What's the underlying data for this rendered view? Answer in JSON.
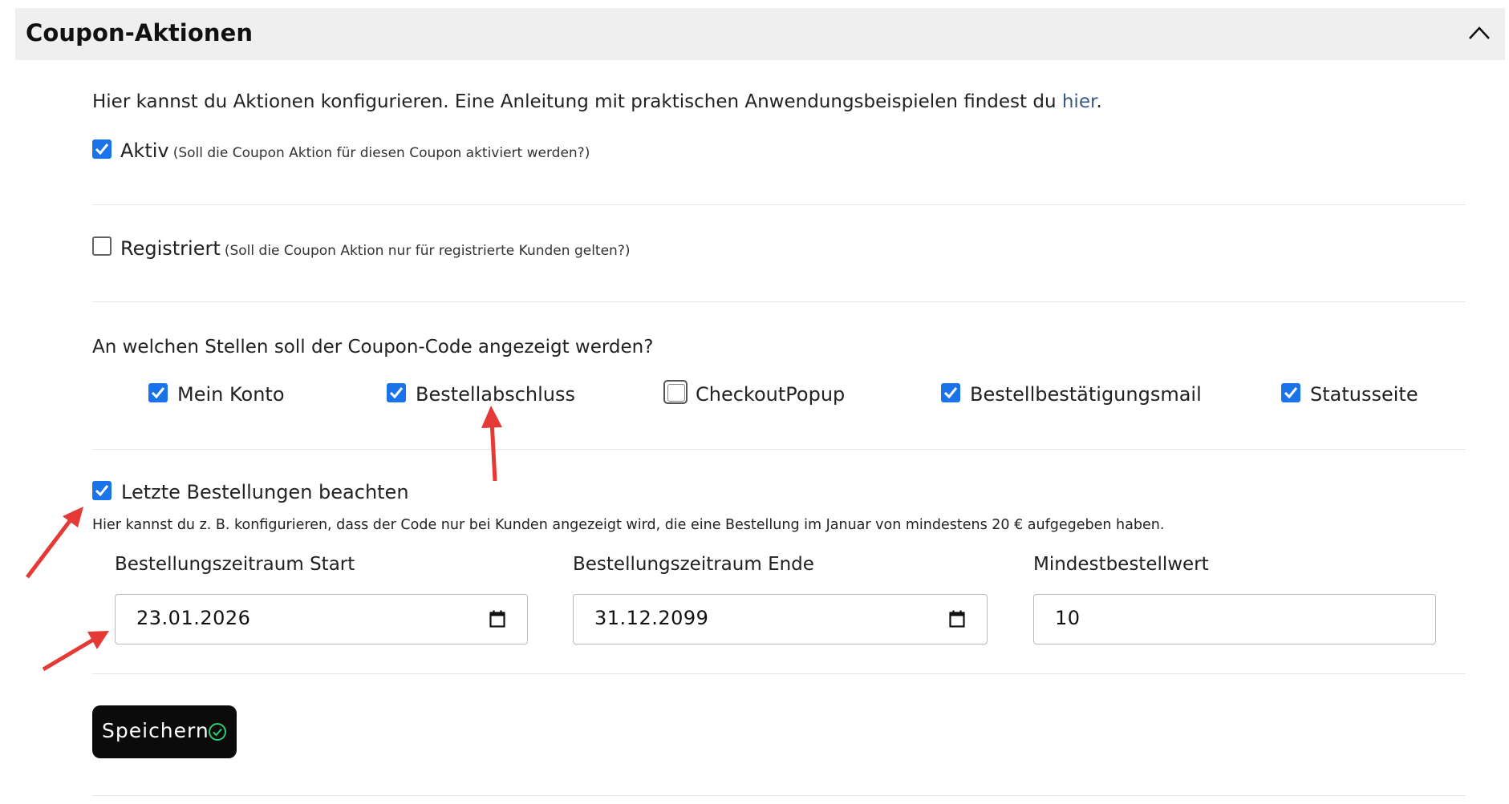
{
  "panel": {
    "title": "Coupon-Aktionen",
    "collapse_icon": "chevron-up-icon"
  },
  "intro": {
    "text": "Hier kannst du Aktionen konfigurieren. Eine Anleitung mit praktischen Anwendungsbeispielen findest du ",
    "link_text": "hier",
    "suffix": "."
  },
  "aktiv": {
    "label": "Aktiv",
    "hint": "(Soll die Coupon Aktion für diesen Coupon aktiviert werden?)",
    "checked": true
  },
  "registriert": {
    "label": "Registriert",
    "hint": "(Soll die Coupon Aktion nur für registrierte Kunden gelten?)",
    "checked": false
  },
  "placement": {
    "question": "An welchen Stellen soll der Coupon-Code angezeigt werden?",
    "options": [
      {
        "label": "Mein Konto",
        "checked": true
      },
      {
        "label": "Bestellabschluss",
        "checked": true
      },
      {
        "label": "CheckoutPopup",
        "checked": false
      },
      {
        "label": "Bestellbestätigungsmail",
        "checked": true
      },
      {
        "label": "Statusseite",
        "checked": true
      }
    ]
  },
  "last_orders": {
    "label": "Letzte Bestellungen beachten",
    "checked": true,
    "description": "Hier kannst du z. B. konfigurieren, dass der Code nur bei Kunden angezeigt wird, die eine Bestellung im Januar von mindestens 20 € aufgegeben haben.",
    "start": {
      "label": "Bestellungszeitraum Start",
      "value": "23.01.2026"
    },
    "end": {
      "label": "Bestellungszeitraum Ende",
      "value": "31.12.2099"
    },
    "min": {
      "label": "Mindestbestellwert",
      "value": "10"
    }
  },
  "save": {
    "label": "Speichern",
    "icon": "check-circle-icon"
  },
  "colors": {
    "checkbox": "#1a73e8",
    "annotation_arrow": "#e53935",
    "link": "#3a5a86",
    "button_bg": "#0b0b0b",
    "button_check": "#2ecc71"
  }
}
